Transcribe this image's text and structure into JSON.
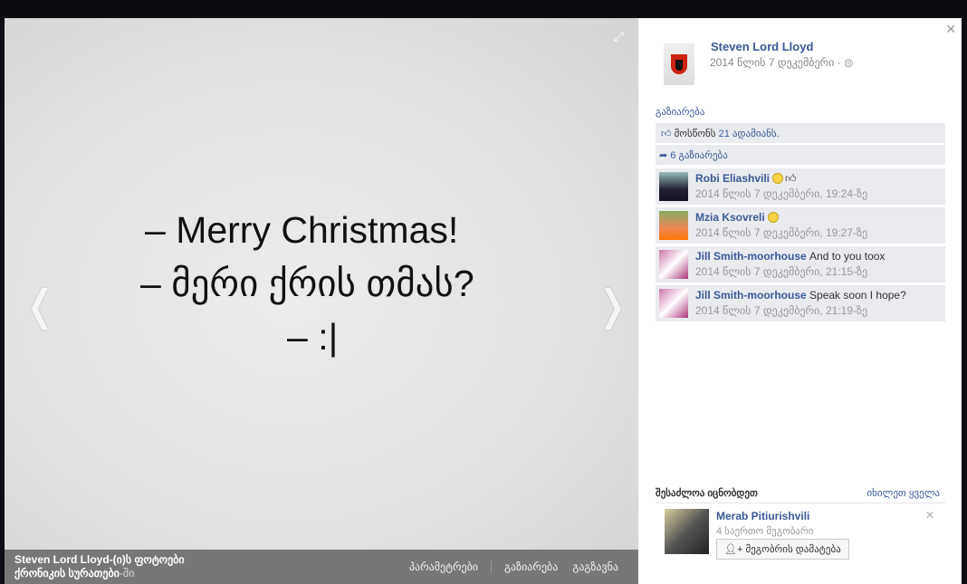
{
  "photo": {
    "line1": "– Merry Christmas!",
    "line2": "– მერი ქრის თმას?",
    "line3": "– :|",
    "owner": "Steven Lord Lloyd-(ი)ს ფოტოები",
    "album": "ქრონიკის სურათები",
    "album_suffix": "-ში",
    "actions": {
      "options": "პარამეტრები",
      "share": "გაზიარება",
      "send": "გაგზავნა"
    }
  },
  "post": {
    "author": "Steven Lord Lloyd",
    "date": "2014 წლის 7 დეკემბერი ·",
    "share_link": "გაზიარება",
    "likes_prefix": "მოსწონს ",
    "likes_count": "21 ადამიანს.",
    "shares": "6 გაზიარება"
  },
  "comments": [
    {
      "name": "Robi Eliashvili",
      "text": "",
      "time": "2014 წლის 7 დეკემბერი, 19:24-ზე"
    },
    {
      "name": "Mzia Ksovreli",
      "text": "",
      "time": "2014 წლის 7 დეკემბერი, 19:27-ზე"
    },
    {
      "name": "Jill Smith-moorhouse",
      "text": "And to you toox",
      "time": "2014 წლის 7 დეკემბერი, 21:15-ზე"
    },
    {
      "name": "Jill Smith-moorhouse",
      "text": "Speak soon I hope?",
      "time": "2014 წლის 7 დეკემბერი, 21:19-ზე"
    }
  ],
  "pymk": {
    "title": "შესაძლოა იცნობდეთ",
    "see_all": "იხილეთ ყველა",
    "name": "Merab Pitiurishvili",
    "mutual": "4 საერთო მეგობარი",
    "add": "მეგობრის დამატება"
  }
}
